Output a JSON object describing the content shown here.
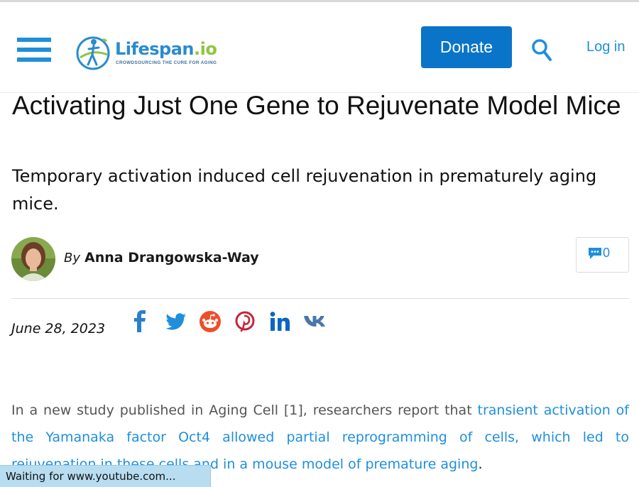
{
  "header": {
    "logo": {
      "name_part1": "Lifespan",
      "name_part2": ".io",
      "tagline": "CROWDSOURCING THE CURE FOR AGING"
    },
    "donate_label": "Donate",
    "login_label": "Log in",
    "icons": [
      "hamburger-menu-icon",
      "search-icon"
    ]
  },
  "article": {
    "title": "Activating Just One Gene to Rejuvenate Model Mice",
    "subtitle": "Temporary activation induced cell rejuvenation in prematurely aging mice.",
    "byline_prefix": "By",
    "author": "Anna Drangowska-Way",
    "comment_count": "0",
    "date": "June 28, 2023",
    "share_icons": [
      "facebook-icon",
      "twitter-icon",
      "reddit-icon",
      "pinterest-icon",
      "linkedin-icon",
      "vk-icon"
    ],
    "body_plain": "In a new study published in Aging Cell [1], researchers report that ",
    "body_link": "transient activation of the Yamanaka factor Oct4 allowed partial reprogramming of cells, which led to rejuvenation in these cells and in a mouse model of premature aging",
    "body_end": "."
  },
  "status_bar": "Waiting for www.youtube.com...",
  "colors": {
    "accent": "#1f8fdc",
    "donate_bg": "#0a74c8",
    "brand_green": "#8cc63f",
    "status_bg": "#b8ddf0"
  }
}
